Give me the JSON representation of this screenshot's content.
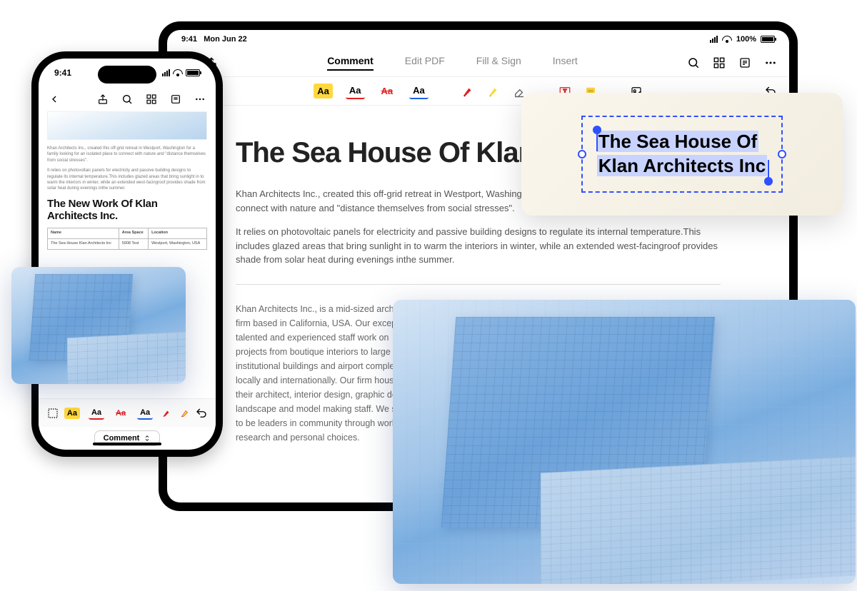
{
  "ipad": {
    "status": {
      "time": "9:41",
      "date": "Mon Jun 22",
      "battery": "100%"
    },
    "nav": {
      "tabs": {
        "comment": "Comment",
        "editpdf": "Edit PDF",
        "fillsign": "Fill & Sign",
        "insert": "Insert"
      }
    },
    "tools": {
      "aa": "Aa"
    },
    "doc": {
      "title": "The Sea House Of Klan Architects Inc",
      "p1": "Khan Architects Inc., created this off-grid retreat in Westport, Washington for a family looking for an isolated place to connect with nature and \"distance themselves from social stresses\".",
      "p2": "It relies on photovoltaic panels for electricity and passive building designs to regulate its internal temperature.This includes glazed areas that bring sunlight in to warm the interiors in winter, while an extended west-facingroof provides shade from solar heat during evenings inthe summer.",
      "p3": "Khan Architects Inc., is a mid-sized architect firm based in California, USA. Our exceptional, talented and experienced staff work on projects from boutique interiors to large institutional buildings and airport complexes, locally and internationally. Our firm houses their architect, interior design, graphic design, landscape and model making staff. We strieve to be leaders in community through work, research and personal choices."
    }
  },
  "iphone": {
    "status": {
      "time": "9:41"
    },
    "doc": {
      "p1": "Khan Architects Inc., created this off-grid retreat in Westport, Washington for a family looking for an isolated place to connect with nature and \"distance themselves from social stresses\".",
      "p2": "It relies on photovoltaic panels for electricity and passive building designs to regulate its internal temperature.This includes glazed areas that bring sunlight in to warm the interiors in winter, while an extended west-facingroof provides shade from solar heat during evenings inthe summer.",
      "h2": "The New Work Of Klan Architects Inc.",
      "table": {
        "headers": {
          "name": "Name",
          "area": "Area Space",
          "location": "Location"
        },
        "row": {
          "name": "The Sea House Klan Architects Inc",
          "area": "5908 Test",
          "location": "Westport, Washington, USA"
        }
      }
    },
    "mode": {
      "label": "Comment"
    }
  },
  "callout": {
    "line1": "The Sea House Of",
    "line2": "Klan Architects Inc"
  },
  "tools_aa": "Aa"
}
